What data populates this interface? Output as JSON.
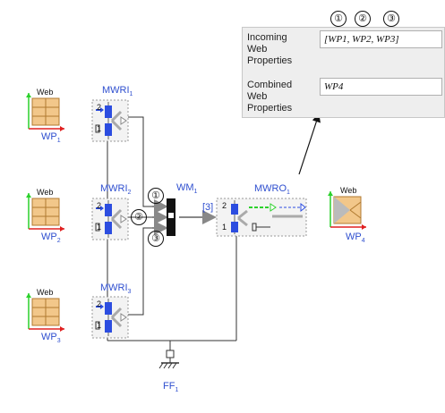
{
  "sources": [
    {
      "label": "Web",
      "name": "WP",
      "sub": "1"
    },
    {
      "label": "Web",
      "name": "WP",
      "sub": "2"
    },
    {
      "label": "Web",
      "name": "WP",
      "sub": "3"
    }
  ],
  "inputs": [
    {
      "name": "MWRI",
      "sub": "1"
    },
    {
      "name": "MWRI",
      "sub": "2"
    },
    {
      "name": "MWRI",
      "sub": "3"
    }
  ],
  "merger": {
    "name": "WM",
    "sub": "1",
    "bus_label": "[3]"
  },
  "output": {
    "name": "MWRO",
    "sub": "1"
  },
  "sink": {
    "label": "Web",
    "name": "WP",
    "sub": "4"
  },
  "ground": {
    "name": "FF",
    "sub": "1"
  },
  "port_numbers": {
    "two": "2",
    "one": "1"
  },
  "circled": [
    "①",
    "②",
    "③"
  ],
  "properties": {
    "incoming_label": "Incoming\nWeb\nProperties",
    "incoming_value": "[WP1, WP2, WP3]",
    "combined_label": "Combined\nWeb\nProperties",
    "combined_value": "WP4"
  },
  "colors": {
    "label_blue": "#2f4fcf",
    "port_blue": "#2c4de0",
    "arrow_green": "#2bd12b",
    "arrow_red": "#e02020",
    "grid_orange": "#f2c78a"
  }
}
